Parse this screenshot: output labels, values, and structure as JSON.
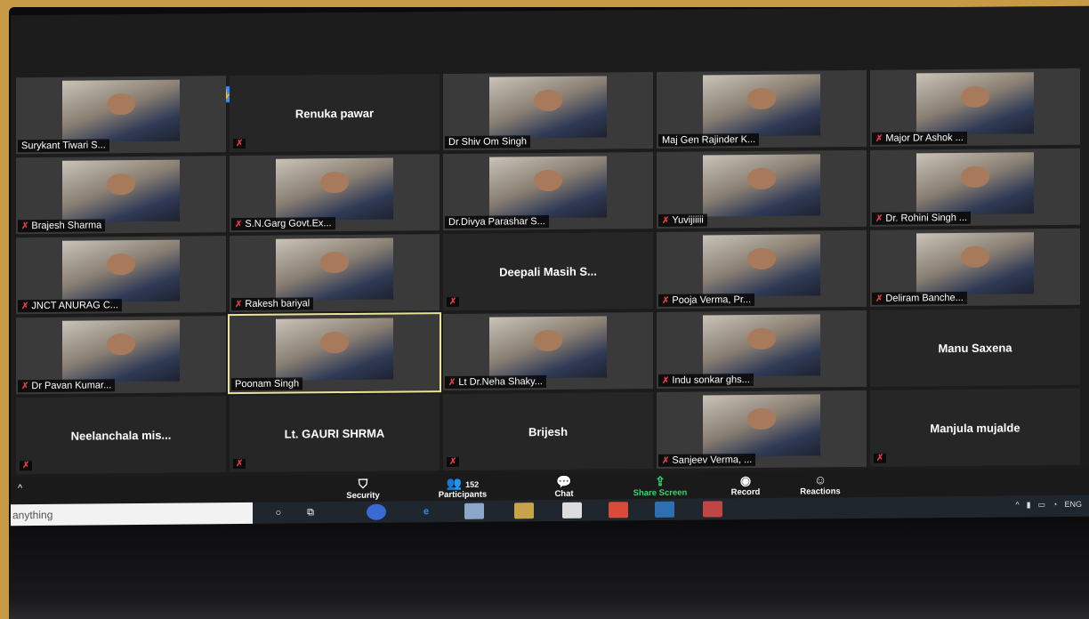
{
  "tiles": [
    {
      "name": "Surykant Tiwari S...",
      "type": "video",
      "muted": false
    },
    {
      "name": "Renuka pawar",
      "type": "name",
      "muted": true
    },
    {
      "name": "Dr Shiv Om Singh",
      "type": "video",
      "muted": false
    },
    {
      "name": "Maj Gen Rajinder K...",
      "type": "video",
      "muted": false
    },
    {
      "name": "Major Dr Ashok ...",
      "type": "video",
      "muted": true
    },
    {
      "name": "Brajesh Sharma",
      "type": "video",
      "muted": true
    },
    {
      "name": "S.N.Garg Govt.Ex...",
      "type": "video",
      "muted": true
    },
    {
      "name": "Dr.Divya Parashar S...",
      "type": "video",
      "muted": false
    },
    {
      "name": "Yuvijiiiii",
      "type": "video",
      "muted": true
    },
    {
      "name": "Dr. Rohini Singh ...",
      "type": "video",
      "muted": true
    },
    {
      "name": "JNCT ANURAG C...",
      "type": "video",
      "muted": true
    },
    {
      "name": "Rakesh bariyal",
      "type": "video",
      "muted": true
    },
    {
      "name": "Deepali Masih S...",
      "type": "name",
      "muted": true
    },
    {
      "name": "Pooja Verma, Pr...",
      "type": "video",
      "muted": true
    },
    {
      "name": "Deliram Banche...",
      "type": "video",
      "muted": true
    },
    {
      "name": "Dr Pavan Kumar...",
      "type": "video",
      "muted": true
    },
    {
      "name": "Poonam Singh",
      "type": "video",
      "muted": false,
      "active": true
    },
    {
      "name": "Lt Dr.Neha Shaky...",
      "type": "video",
      "muted": true
    },
    {
      "name": "Indu sonkar ghs...",
      "type": "video",
      "muted": true
    },
    {
      "name": "Manu Saxena",
      "type": "name",
      "muted": false
    },
    {
      "name": "Neelanchala mis...",
      "type": "name",
      "muted": true
    },
    {
      "name": "Lt. GAURI SHRMA",
      "type": "name",
      "muted": true
    },
    {
      "name": "Brijesh",
      "type": "name",
      "muted": true
    },
    {
      "name": "Sanjeev Verma, ...",
      "type": "video",
      "muted": true
    },
    {
      "name": "Manjula mujalde",
      "type": "name",
      "muted": true
    }
  ],
  "toolbar": {
    "security": "Security",
    "participants": "Participants",
    "participant_count": "152",
    "chat": "Chat",
    "share": "Share Screen",
    "record": "Record",
    "reactions": "Reactions"
  },
  "taskbar": {
    "search_placeholder": "anything",
    "lang": "ENG"
  },
  "colors": {
    "muted": "#e23b3b",
    "raise_hand": "#2d8cff",
    "active_speaker": "#e8e49a"
  }
}
